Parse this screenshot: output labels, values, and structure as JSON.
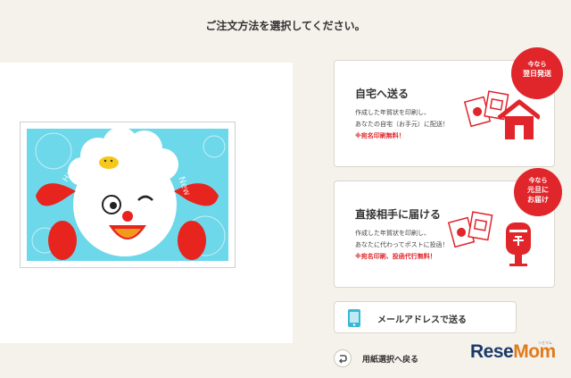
{
  "header": {
    "title": "ご注文方法を選択してください。"
  },
  "options": [
    {
      "title": "自宅へ送る",
      "desc_line1": "作成した年賀状を印刷し、",
      "desc_line2": "あなたの自宅（お手元）に配送！",
      "note": "※宛名印刷無料！",
      "badge_small": "今なら",
      "badge_big": "翌日発送"
    },
    {
      "title": "直接相手に届ける",
      "desc_line1": "作成した年賀状を印刷し、",
      "desc_line2": "あなたに代わってポストに投函！",
      "note": "※宛名印刷、投函代行無料！",
      "badge_small": "今なら",
      "badge_big1": "元旦に",
      "badge_big2": "お届け"
    }
  ],
  "mail_button": {
    "label": "メールアドレスで送る"
  },
  "back_link": {
    "label": "用紙選択へ戻る"
  },
  "watermark": {
    "text_a": "Rese",
    "text_b": "Mom",
    "ruby": "リセマム"
  },
  "colors": {
    "accent_red": "#e0252b",
    "background": "#f5f1eb",
    "card_sky": "#6cd8ea"
  },
  "card_art": {
    "postcard_text": "2015 Happy New Year"
  }
}
